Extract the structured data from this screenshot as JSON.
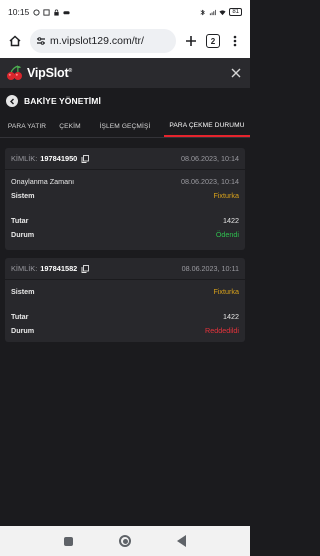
{
  "status_bar": {
    "time": "10:15",
    "battery": "81"
  },
  "browser": {
    "url": "m.vipslot129.com/tr/",
    "tab_count": "2"
  },
  "app": {
    "logo_vip": "Vip",
    "logo_slot": "Slot",
    "logo_mark": "®"
  },
  "page": {
    "title": "BAKİYE YÖNETİMİ"
  },
  "tabs": [
    {
      "label": "PARA YATIR"
    },
    {
      "label": "ÇEKİM"
    },
    {
      "label": "İŞLEM GEÇMİŞİ"
    },
    {
      "label": "PARA ÇEKME DURUMU"
    }
  ],
  "cards": [
    {
      "id_label": "KİMLİK:",
      "id_value": "197841950",
      "date": "08.06.2023, 10:14",
      "rows": [
        {
          "key": "Onaylanma Zamanı",
          "value": "08.06.2023, 10:14"
        },
        {
          "key": "Sistem",
          "value": "Fixturka"
        },
        {
          "key": "Tutar",
          "value": "1422"
        },
        {
          "key": "Durum",
          "value": "Ödendi"
        }
      ]
    },
    {
      "id_label": "KİMLİK:",
      "id_value": "197841582",
      "date": "08.06.2023, 10:11",
      "rows": [
        {
          "key": "Sistem",
          "value": "Fixturka"
        },
        {
          "key": "Tutar",
          "value": "1422"
        },
        {
          "key": "Durum",
          "value": "Reddedildi"
        }
      ]
    }
  ],
  "colors": {
    "accent": "#e5242d",
    "system_value": "#d9a21b",
    "status_paid": "#2fbf4f",
    "status_rejected": "#e5333b",
    "background": "#1b1b1e",
    "card": "#28282c"
  }
}
